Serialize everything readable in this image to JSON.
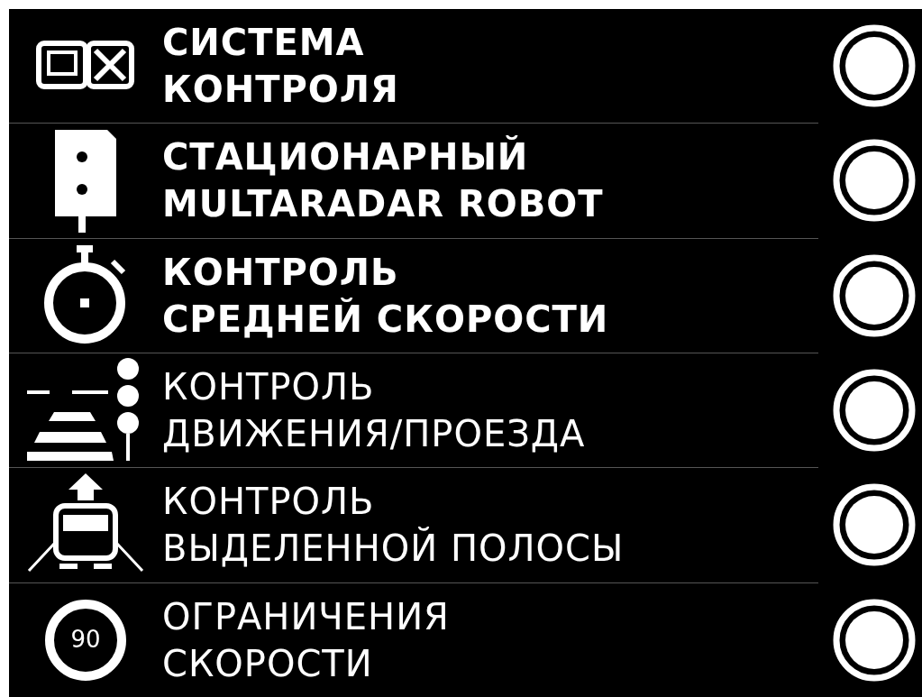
{
  "items": [
    {
      "kind": "control-system",
      "lines": [
        "СИСТЕМА",
        "КОНТРОЛЯ"
      ],
      "bold": true,
      "on": true
    },
    {
      "kind": "radar",
      "lines": [
        "СТАЦИОНАРНЫЙ",
        "MULTARADAR ROBOT"
      ],
      "bold": true,
      "on": true
    },
    {
      "kind": "stopwatch",
      "lines": [
        "КОНТРОЛЬ",
        "СРЕДНЕЙ СКОРОСТИ"
      ],
      "bold": true,
      "on": true
    },
    {
      "kind": "traffic",
      "lines": [
        "КОНТРОЛЬ",
        "ДВИЖЕНИЯ/ПРОЕЗДА"
      ],
      "bold": false,
      "on": true
    },
    {
      "kind": "lane",
      "lines": [
        "КОНТРОЛЬ",
        "ВЫДЕЛЕННОЙ ПОЛОСЫ"
      ],
      "bold": false,
      "on": true
    },
    {
      "kind": "limit",
      "badge": "90",
      "lines": [
        "ОГРАНИЧЕНИЯ",
        "СКОРОСТИ"
      ],
      "bold": false,
      "on": true
    }
  ]
}
